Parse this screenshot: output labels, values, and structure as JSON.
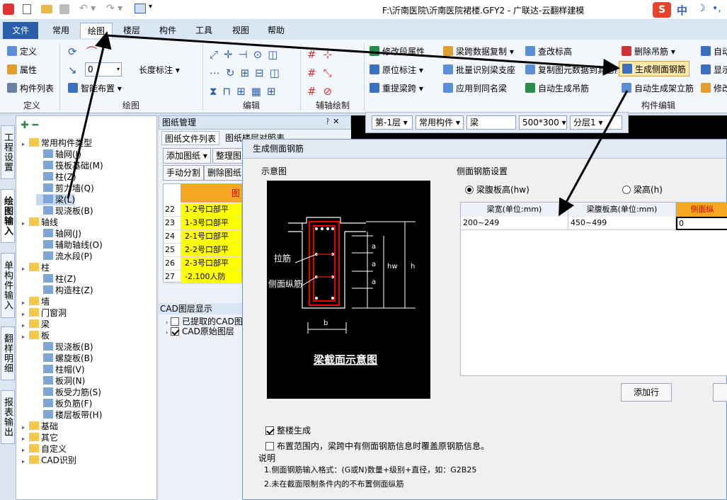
{
  "titlebar": {
    "title": "F:\\沂南医院\\沂南医院裙楼.GFY2 - 广联达-云翻样建模",
    "ime": "中"
  },
  "menu": {
    "file": "文件",
    "tabs": [
      "常用",
      "绘图",
      "楼层",
      "构件",
      "工具",
      "视图",
      "帮助"
    ]
  },
  "ribbon": {
    "define": {
      "items": [
        "定义",
        "属性",
        "构件列表"
      ],
      "label": "定义"
    },
    "draw": {
      "length_value": "0",
      "length_label": "长度标注",
      "smart_layout": "智能布置",
      "label": "绘图"
    },
    "edit": {
      "label": "编辑"
    },
    "axis": {
      "label": "辅轴绘制"
    },
    "comp": {
      "items": [
        "修改段属性",
        "原位标注",
        "重提梁跨",
        "梁跨数据复制",
        "批量识别梁支座",
        "应用到同名梁",
        "查改标高",
        "复制图元数据到其它层",
        "自动生成吊筋",
        "删除吊筋",
        "生成侧面钢筋",
        "自动生成架立筋",
        "自动",
        "显示",
        "修改"
      ],
      "label": "构件编辑"
    }
  },
  "vtabs": [
    "工程设置",
    "绘图输入",
    "单构件输入",
    "翻样明细",
    "报表输出"
  ],
  "tree": [
    {
      "label": "常用构件类型",
      "level": 0,
      "type": "folder"
    },
    {
      "label": "轴网(J)",
      "level": 1,
      "type": "leaf"
    },
    {
      "label": "筏板基础(M)",
      "level": 1,
      "type": "leaf"
    },
    {
      "label": "柱(Z)",
      "level": 1,
      "type": "leaf"
    },
    {
      "label": "剪力墙(Q)",
      "level": 1,
      "type": "leaf"
    },
    {
      "label": "梁(L)",
      "level": 1,
      "type": "leaf",
      "selected": true
    },
    {
      "label": "现浇板(B)",
      "level": 1,
      "type": "leaf"
    },
    {
      "label": "轴线",
      "level": 0,
      "type": "folder"
    },
    {
      "label": "轴网(J)",
      "level": 1,
      "type": "leaf"
    },
    {
      "label": "辅助轴线(O)",
      "level": 1,
      "type": "leaf"
    },
    {
      "label": "流水段(P)",
      "level": 1,
      "type": "leaf"
    },
    {
      "label": "柱",
      "level": 0,
      "type": "folder"
    },
    {
      "label": "柱(Z)",
      "level": 1,
      "type": "leaf"
    },
    {
      "label": "构造柱(Z)",
      "level": 1,
      "type": "leaf"
    },
    {
      "label": "墙",
      "level": 0,
      "type": "folder"
    },
    {
      "label": "门窗洞",
      "level": 0,
      "type": "folder"
    },
    {
      "label": "梁",
      "level": 0,
      "type": "folder"
    },
    {
      "label": "板",
      "level": 0,
      "type": "folder"
    },
    {
      "label": "现浇板(B)",
      "level": 1,
      "type": "leaf"
    },
    {
      "label": "螺旋板(B)",
      "level": 1,
      "type": "leaf"
    },
    {
      "label": "柱帽(V)",
      "level": 1,
      "type": "leaf"
    },
    {
      "label": "板洞(N)",
      "level": 1,
      "type": "leaf"
    },
    {
      "label": "板受力筋(S)",
      "level": 1,
      "type": "leaf"
    },
    {
      "label": "板负筋(F)",
      "level": 1,
      "type": "leaf"
    },
    {
      "label": "楼层板带(H)",
      "level": 1,
      "type": "leaf"
    },
    {
      "label": "基础",
      "level": 0,
      "type": "folder"
    },
    {
      "label": "其它",
      "level": 0,
      "type": "folder"
    },
    {
      "label": "自定义",
      "level": 0,
      "type": "folder"
    },
    {
      "label": "CAD识别",
      "level": 0,
      "type": "folder"
    }
  ],
  "drawing_panel": {
    "title": "图纸管理",
    "tabs": [
      "图纸文件列表",
      "图纸楼层对照表"
    ],
    "buttons": [
      "添加图纸",
      "整理图",
      "手动分割",
      "删除图纸"
    ],
    "col_header": "图",
    "rows": [
      {
        "n": "22",
        "t": "1-2号口部平"
      },
      {
        "n": "23",
        "t": "1-3号口部平"
      },
      {
        "n": "24",
        "t": "2-1号口部平"
      },
      {
        "n": "25",
        "t": "2-2号口部平"
      },
      {
        "n": "26",
        "t": "2-3号口部平"
      },
      {
        "n": "27",
        "t": "-2.100人防"
      }
    ]
  },
  "cad_layers": {
    "title": "CAD图层显示",
    "items": [
      "已提取的CAD图",
      "CAD原始图层"
    ]
  },
  "toolbar2": {
    "floor": "第-1层",
    "type": "常用构件",
    "comp": "梁",
    "size": "500*300",
    "layer": "分层1"
  },
  "dialog": {
    "title": "生成侧面钢筋",
    "schematic_label": "示意图",
    "settings_label": "侧面钢筋设置",
    "radio1": "梁腹板高(hw)",
    "radio2": "梁高(h)",
    "columns": [
      "梁宽(单位:mm)",
      "梁腹板高(单位:mm)",
      "侧面纵"
    ],
    "row": [
      "200~249",
      "450~499",
      "0"
    ],
    "add_row": "添加行",
    "diagram": {
      "lajin": "拉筋",
      "cemian": "侧面纵筋",
      "title": "梁截面示意图",
      "a": "a",
      "hw": "hw",
      "h": "h",
      "b": "b"
    },
    "chk_whole": "整楼生成",
    "chk_cover": "布置范围内，梁跨中有侧面钢筋信息时覆盖原钢筋信息。",
    "notes_title": "说明",
    "note1": "1.侧面钢筋输入格式：(G或N)数量+级别+直径，如：G2B25",
    "note2": "2.未在截面限制条件内的不布置侧面纵筋"
  }
}
